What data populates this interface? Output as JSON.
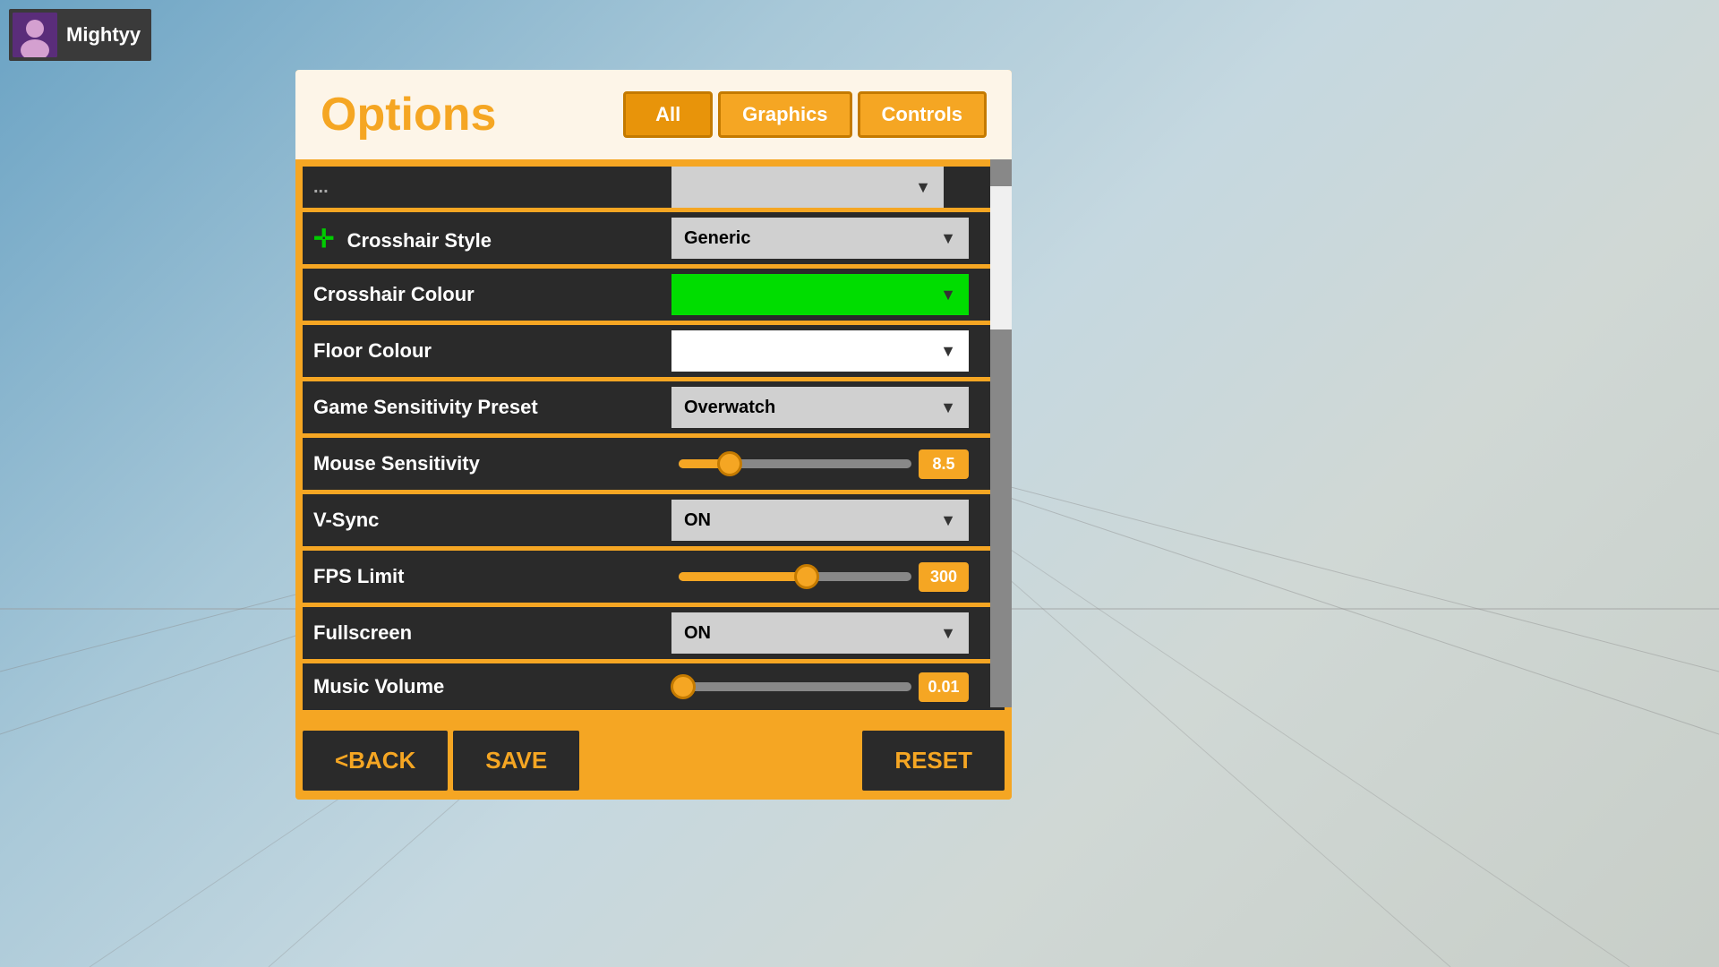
{
  "background": {
    "description": "gradient blue-gray game background with floor lines"
  },
  "userProfile": {
    "name": "Mightyy",
    "avatarEmoji": "👤"
  },
  "modal": {
    "title": "Options",
    "tabs": [
      {
        "label": "All",
        "active": true
      },
      {
        "label": "Graphics",
        "active": false
      },
      {
        "label": "Controls",
        "active": false
      }
    ],
    "settings": [
      {
        "id": "partial-top",
        "type": "partial",
        "label": "...",
        "control": {
          "type": "partial-dropdown",
          "value": ""
        }
      },
      {
        "id": "crosshair-style",
        "type": "dropdown",
        "label": "Crosshair Style",
        "hasCrosshairIcon": true,
        "control": {
          "type": "dropdown",
          "value": "Generic",
          "colorClass": ""
        }
      },
      {
        "id": "crosshair-colour",
        "type": "dropdown",
        "label": "Crosshair Colour",
        "control": {
          "type": "dropdown",
          "value": "",
          "colorClass": "green"
        }
      },
      {
        "id": "floor-colour",
        "type": "dropdown",
        "label": "Floor Colour",
        "control": {
          "type": "dropdown",
          "value": "",
          "colorClass": "white"
        }
      },
      {
        "id": "game-sensitivity-preset",
        "type": "dropdown",
        "label": "Game Sensitivity Preset",
        "control": {
          "type": "dropdown",
          "value": "Overwatch",
          "colorClass": ""
        }
      },
      {
        "id": "mouse-sensitivity",
        "type": "slider",
        "label": "Mouse Sensitivity",
        "control": {
          "type": "slider",
          "value": "8.5",
          "fillPercent": 22
        }
      },
      {
        "id": "vsync",
        "type": "dropdown",
        "label": "V-Sync",
        "control": {
          "type": "dropdown",
          "value": "ON",
          "colorClass": ""
        }
      },
      {
        "id": "fps-limit",
        "type": "slider",
        "label": "FPS Limit",
        "control": {
          "type": "slider",
          "value": "300",
          "fillPercent": 55
        }
      },
      {
        "id": "fullscreen",
        "type": "dropdown",
        "label": "Fullscreen",
        "control": {
          "type": "dropdown",
          "value": "ON",
          "colorClass": ""
        }
      },
      {
        "id": "music-volume",
        "type": "slider-partial",
        "label": "Music Volume",
        "control": {
          "type": "slider",
          "value": "0.01",
          "fillPercent": 2
        }
      }
    ],
    "footer": {
      "backLabel": "<BACK",
      "saveLabel": "SAVE",
      "resetLabel": "RESET"
    }
  }
}
